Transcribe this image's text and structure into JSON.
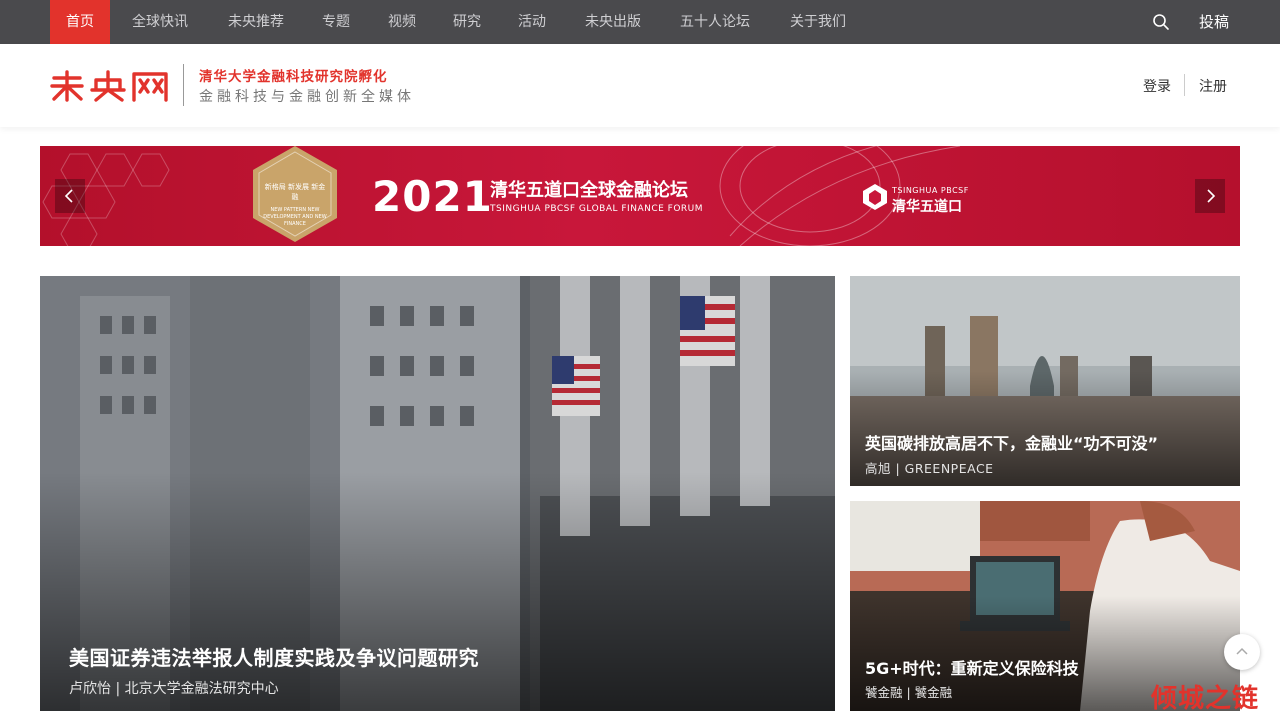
{
  "top_nav": {
    "items": [
      {
        "label": "首页",
        "active": true
      },
      {
        "label": "全球快讯",
        "active": false
      },
      {
        "label": "未央推荐",
        "active": false
      },
      {
        "label": "专题",
        "active": false
      },
      {
        "label": "视频",
        "active": false
      },
      {
        "label": "研究",
        "active": false
      },
      {
        "label": "活动",
        "active": false
      },
      {
        "label": "未央出版",
        "active": false
      },
      {
        "label": "五十人论坛",
        "active": false
      },
      {
        "label": "关于我们",
        "active": false
      }
    ],
    "search_icon": "search-icon",
    "submit_label": "投稿"
  },
  "header": {
    "logo_text": "未央网",
    "slogan_main": "清华大学金融科技研究院孵化",
    "slogan_sub": "金融科技与金融创新全媒体",
    "login_label": "登录",
    "register_label": "注册"
  },
  "banner": {
    "year": "2021",
    "forum_cn": "清华五道口全球金融论坛",
    "forum_en": "TSINGHUA PBCSF GLOBAL FINANCE FORUM",
    "badge_text": "新格局 新发展 新金融",
    "badge_text_en": "NEW PATTERN NEW DEVELOPMENT AND NEW FINANCE",
    "brand_en": "TSINGHUA PBCSF",
    "brand_cn": "清华五道口"
  },
  "features": {
    "main": {
      "title": "美国证券违法举报人制度实践及争议问题研究",
      "meta": "卢欣怡 | 北京大学金融法研究中心"
    },
    "side1": {
      "title": "英国碳排放高居不下，金融业“功不可没”",
      "meta": "高旭 | GREENPEACE"
    },
    "side2": {
      "title": "5G+时代：重新定义保险科技",
      "meta": "饕金融 | 饕金融"
    }
  },
  "watermark": "倾城之链",
  "colors": {
    "brand_red": "#e2332c",
    "nav_bg": "#4a4a4d"
  }
}
